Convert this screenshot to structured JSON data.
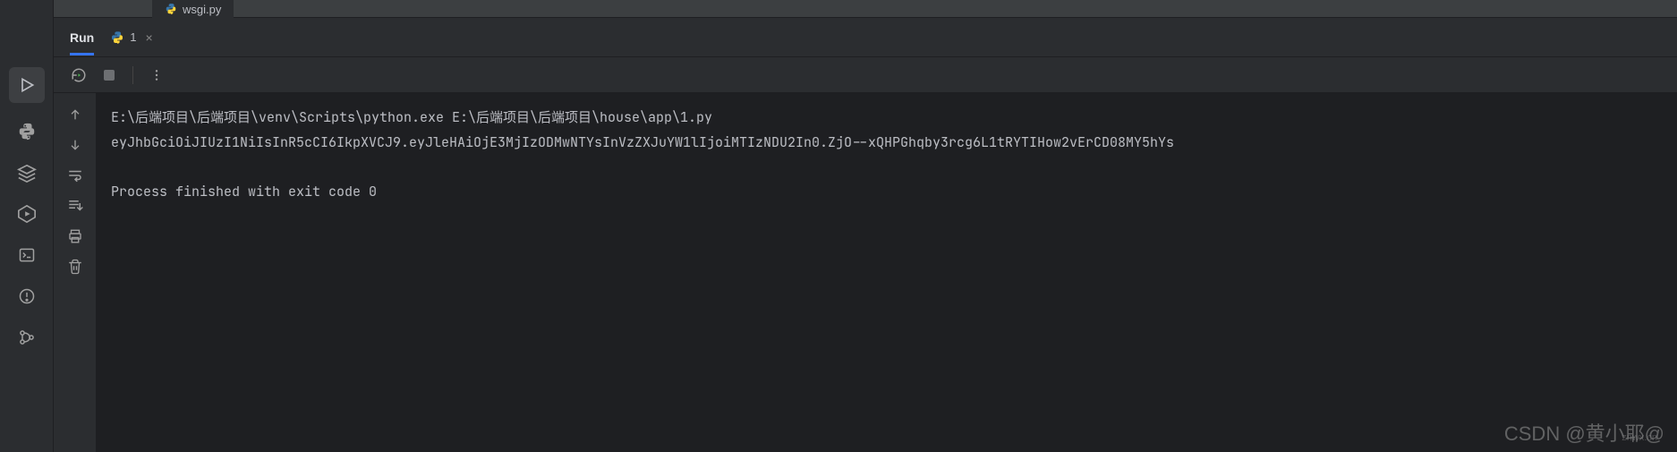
{
  "editor": {
    "tabs": [
      {
        "label": "wsgi.py"
      }
    ]
  },
  "run": {
    "panel_label": "Run",
    "tabs": [
      {
        "label": "1"
      }
    ]
  },
  "console": {
    "line1": "E:\\后端项目\\后端项目\\venv\\Scripts\\python.exe E:\\后端项目\\后端项目\\house\\app\\1.py",
    "line2": "eyJhbGciOiJIUzI1NiIsInR5cCI6IkpXVCJ9.eyJleHAiOjE3MjIzODMwNTYsInVzZXJuYW1lIjoiMTIzNDU2In0.ZjO--xQHPGhqby3rcg6L1tRYTIHow2vErCD08MY5hYs",
    "blank": "",
    "line3": "Process finished with exit code 0"
  },
  "watermark": "CSDN @黄小耶@",
  "watermark2": "znwx.cn"
}
